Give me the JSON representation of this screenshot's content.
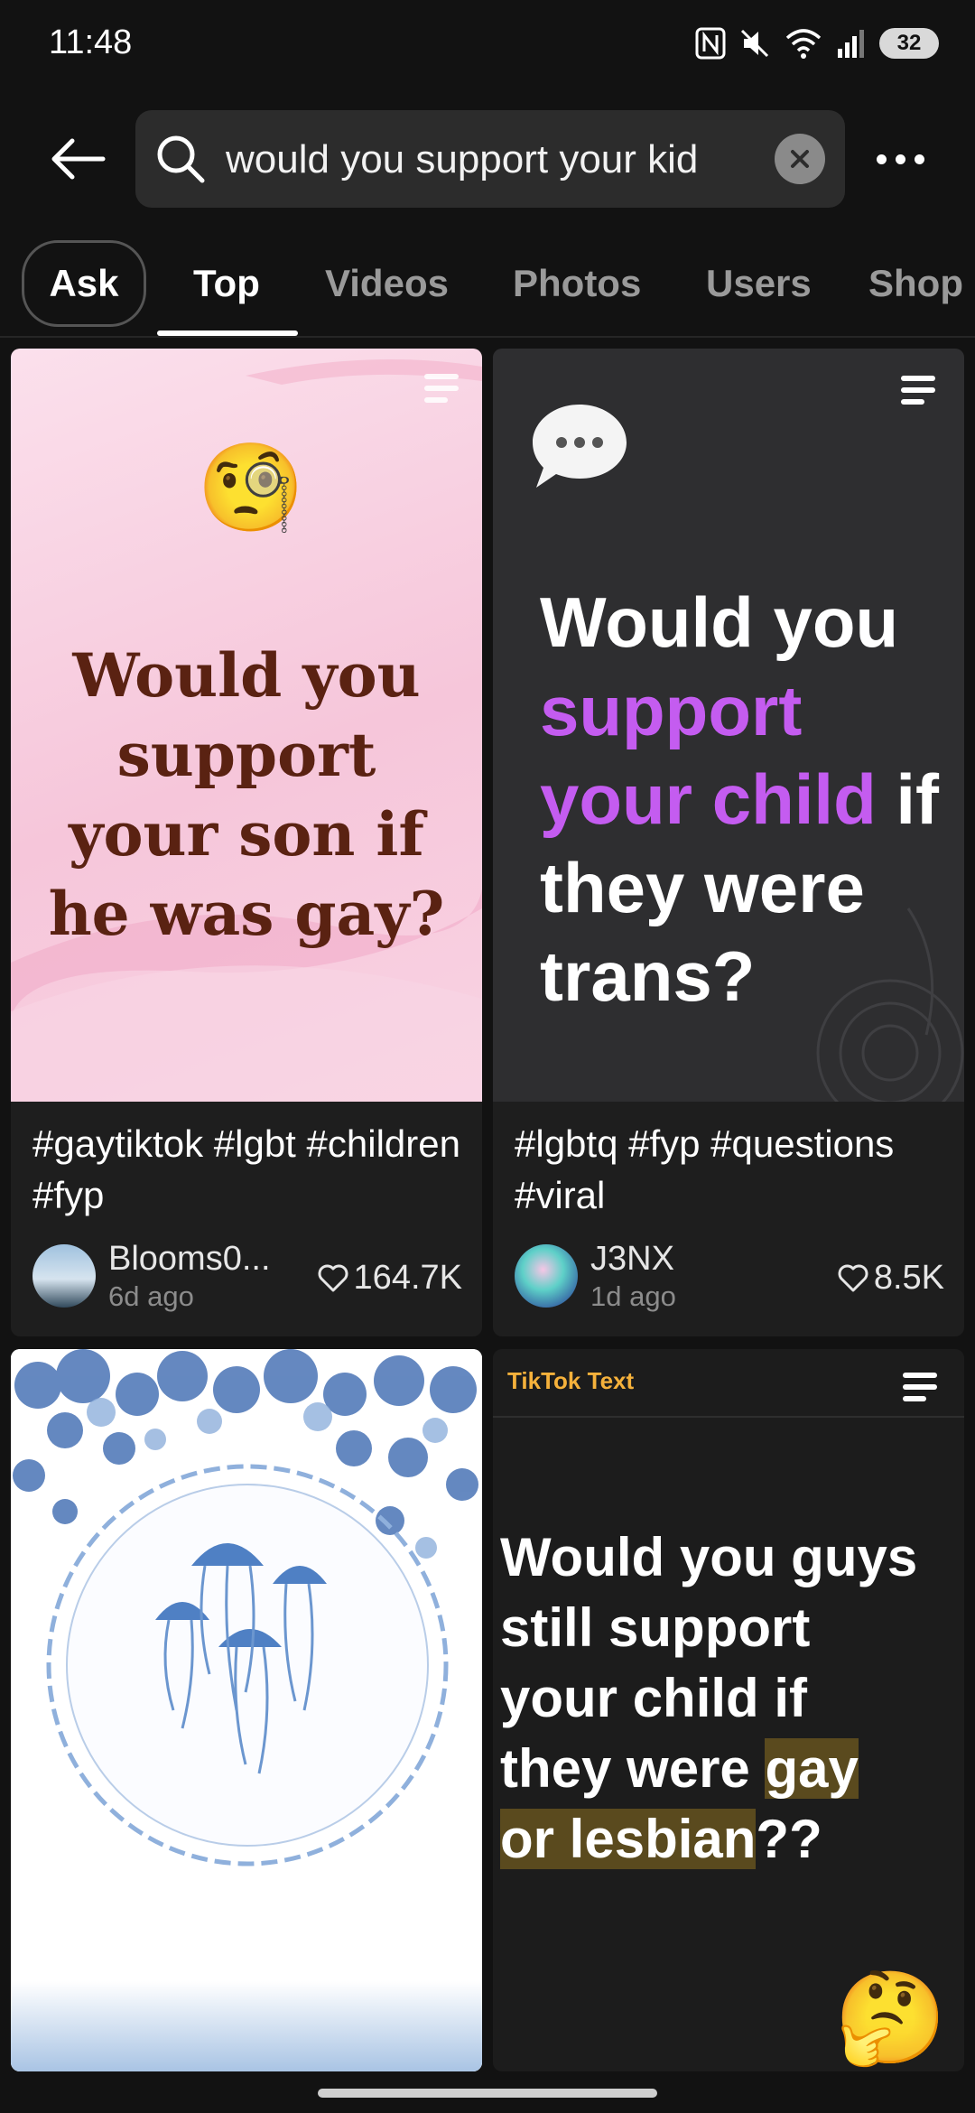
{
  "status_bar": {
    "time": "11:48",
    "battery": "32",
    "icons": [
      "nfc-icon",
      "mute-icon",
      "wifi-icon",
      "signal-icon",
      "battery-icon"
    ]
  },
  "header": {
    "search_query": "would you support your kid",
    "icons": [
      "back-arrow-icon",
      "search-icon",
      "clear-icon",
      "more-icon"
    ]
  },
  "tabs": [
    {
      "label": "Ask"
    },
    {
      "label": "Top",
      "active": true
    },
    {
      "label": "Videos"
    },
    {
      "label": "Photos"
    },
    {
      "label": "Users"
    },
    {
      "label": "Shop"
    }
  ],
  "results": [
    {
      "thumb_text": [
        "Would you",
        "support",
        "your son if",
        "he was gay?"
      ],
      "emoji": "🧐",
      "desc": "#gaytiktok #lgbt #children #fyp",
      "author": "Blooms0...",
      "age": "6d ago",
      "likes": "164.7K"
    },
    {
      "thumb_text_plain1": "Would you",
      "thumb_text_highlight": [
        "support",
        "your child"
      ],
      "thumb_text_plain2": " if",
      "thumb_text_rest": [
        "they were",
        "trans?"
      ],
      "desc": "#lgbtq #fyp #questions #viral",
      "author": "J3NX",
      "age": "1d ago",
      "likes": "8.5K"
    },
    {
      "description": "watercolor jellyfish photo"
    },
    {
      "label": "TikTok Text",
      "thumb_lines": [
        "Would you guys",
        "still support",
        "your child if",
        "they were gay",
        "or lesbian??"
      ],
      "highlight_words": [
        "gay",
        "or lesbian"
      ],
      "emoji": "🤔"
    }
  ],
  "colors": {
    "background": "#121212",
    "card": "#1e1e1e",
    "pink_card": "#f7cfe0",
    "brown_text": "#5a2212",
    "purple_highlight": "#c45cf0"
  }
}
